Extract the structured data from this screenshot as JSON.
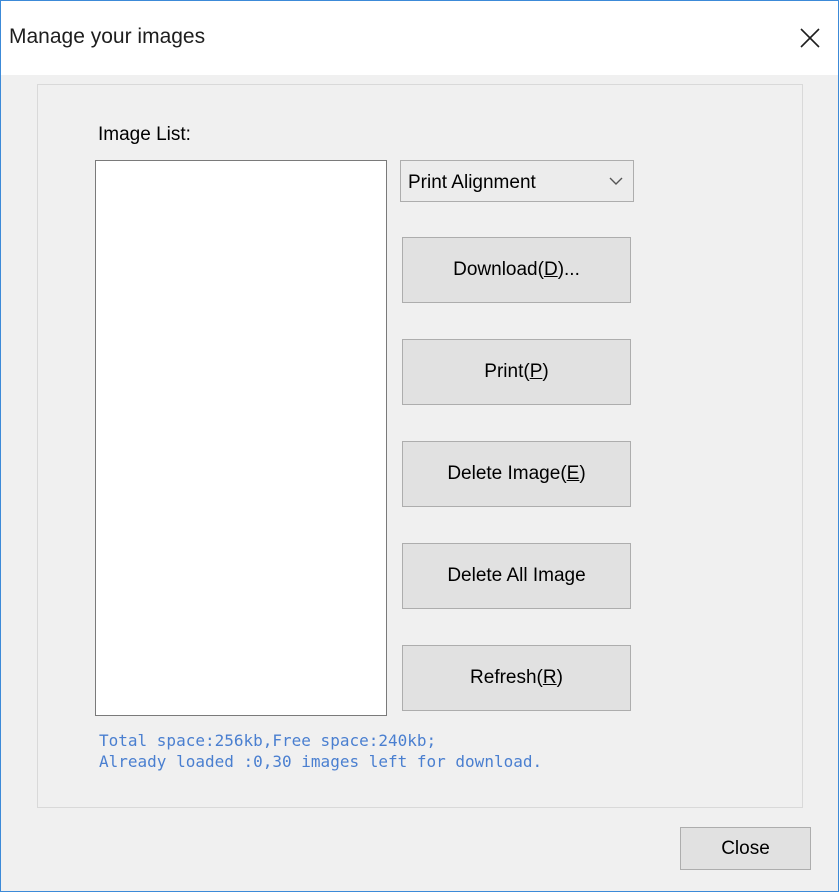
{
  "window": {
    "title": "Manage your images",
    "close_icon": "close-icon"
  },
  "image_list": {
    "label": "Image List:",
    "items": []
  },
  "alignment_select": {
    "value": "Print Alignment",
    "icon": "chevron-down-icon"
  },
  "buttons": {
    "download": {
      "pre": "Download(",
      "mnemonic": "D",
      "post": ")..."
    },
    "print": {
      "pre": "Print(",
      "mnemonic": "P",
      "post": ")"
    },
    "delete_image": {
      "pre": "Delete Image(",
      "mnemonic": "E",
      "post": ")"
    },
    "delete_all": {
      "label": "Delete All Image"
    },
    "refresh": {
      "pre": "Refresh(",
      "mnemonic": "R",
      "post": ")"
    }
  },
  "status": {
    "line1": "Total space:256kb,Free space:240kb;",
    "line2": "Already loaded :0,30 images left for download."
  },
  "footer": {
    "close_label": "Close"
  },
  "colors": {
    "window_border": "#3c8ad8",
    "status_text": "#4a7fd0",
    "dialog_bg": "#f0f0f0"
  }
}
